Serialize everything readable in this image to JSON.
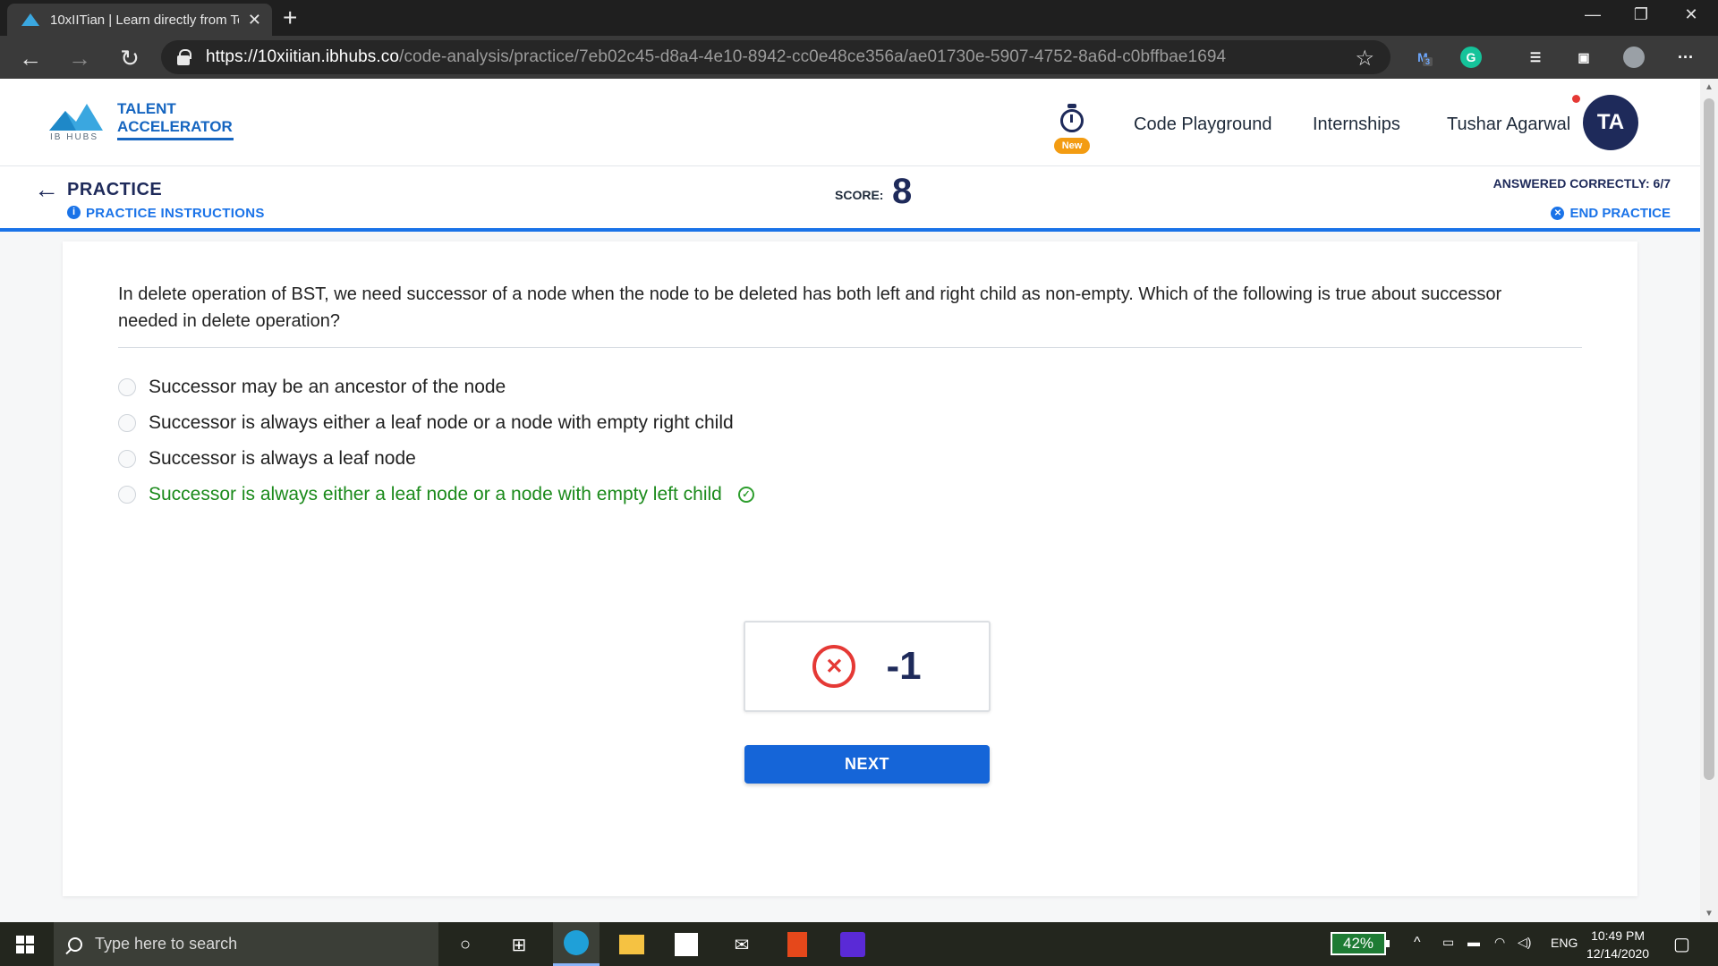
{
  "browser": {
    "tab_title": "10xIITian | Learn directly from To",
    "url_host": "https://10xiitian.ibhubs.co",
    "url_path": "/code-analysis/practice/7eb02c45-d8a4-4e10-8942-cc0e48ce356a/ae01730e-5907-4752-8a6d-c0bffbae1694",
    "extension_badge": "3"
  },
  "header": {
    "logo_sub": "IB HUBS",
    "logo_line1": "TALENT",
    "logo_line2": "ACCELERATOR",
    "new_badge": "New",
    "links": [
      "Code Playground",
      "Internships"
    ],
    "user_name": "Tushar Agarwal",
    "avatar_initials": "TA"
  },
  "practice": {
    "title": "PRACTICE",
    "instructions": "PRACTICE INSTRUCTIONS",
    "score_label": "SCORE:",
    "score_value": "8",
    "answered": "ANSWERED CORRECTLY: 6/7",
    "end": "END PRACTICE"
  },
  "question": {
    "text": "In delete operation of BST, we need successor of a node when the node to be deleted has both left and right child as non-empty. Which of the following is true about successor needed in delete operation?",
    "options": [
      "Successor may be an ancestor of the node",
      "Successor is always either a leaf node or a node with empty right child",
      "Successor is always a leaf node",
      "Successor is always either a leaf node or a node with empty left child"
    ],
    "correct_index": 3,
    "result_delta": "-1",
    "next_label": "NEXT"
  },
  "taskbar": {
    "search_placeholder": "Type here to search",
    "battery": "42%",
    "lang": "ENG",
    "time": "10:49 PM",
    "date": "12/14/2020"
  },
  "colors": {
    "accent": "#1a73e8",
    "correct": "#1b8a1b",
    "wrong": "#e53935",
    "navy": "#1e2a5a"
  }
}
